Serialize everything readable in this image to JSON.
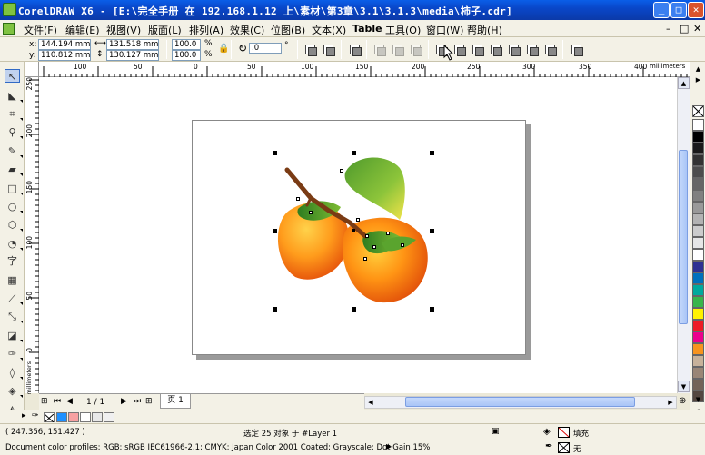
{
  "window": {
    "title": "CorelDRAW X6 - [E:\\完全手册 在 192.168.1.12 上\\素材\\第3章\\3.1\\3.1.3\\media\\柿子.cdr]",
    "minimize_label": "_",
    "maximize_label": "□",
    "close_label": "✕"
  },
  "menu": {
    "items": [
      "文件(F)",
      "编辑(E)",
      "视图(V)",
      "版面(L)",
      "排列(A)",
      "效果(C)",
      "位图(B)",
      "文本(X)",
      "Table",
      "工具(O)",
      "窗口(W)",
      "帮助(H)"
    ],
    "doc_controls": [
      "–",
      "□",
      "✕"
    ]
  },
  "propbar": {
    "x_label": "x:",
    "x_value": "144.194 mm",
    "y_label": "y:",
    "y_value": "110.812 mm",
    "w_value": "131.518 mm",
    "h_value": "130.127 mm",
    "scale_x": "100.0",
    "scale_y": "100.0",
    "percent": "%",
    "rotation": ".0",
    "degree": "°"
  },
  "ruler": {
    "top_ticks": [
      "100",
      "50",
      "0",
      "50",
      "100",
      "150",
      "200",
      "250",
      "300",
      "350",
      "400"
    ],
    "unit": "millimeters",
    "left_ticks": [
      "250",
      "200",
      "150",
      "100",
      "50",
      "0"
    ],
    "left_unit": "millimeters"
  },
  "pagebar": {
    "page_count": "1 / 1",
    "page_tab": "页 1"
  },
  "status": {
    "cursor_pos": "( 247.356, 151.427 )",
    "selection": "选定 25 对象 于 #Layer 1",
    "profiles": "Document color profiles: RGB: sRGB IEC61966-2.1; CMYK: Japan Color 2001 Coated; Grayscale: Dot Gain 15%",
    "fill_label": "填充",
    "outline_label": "无"
  },
  "colors": {
    "palette": [
      "#ffffff",
      "#000000",
      "#1a1a1a",
      "#333333",
      "#4d4d4d",
      "#666666",
      "#808080",
      "#999999",
      "#b3b3b3",
      "#cccccc",
      "#e6e6e6",
      "#ffffff",
      "#2e3192",
      "#0071bc",
      "#00a99d",
      "#39b54a",
      "#fff200",
      "#ed1c24",
      "#ec008c",
      "#f7941d",
      "#c7b299",
      "#998675",
      "#736357",
      "#534741"
    ],
    "doc_palette": [
      "#1e90ff",
      "#f7a1a1",
      "#ffffff",
      "#e8e8e8",
      "#f0f0f0"
    ]
  }
}
